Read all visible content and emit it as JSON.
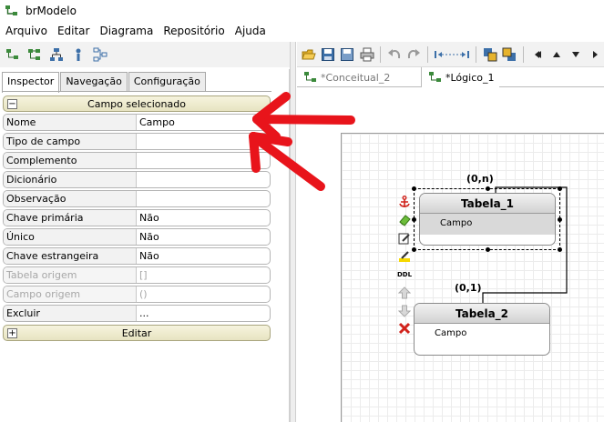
{
  "window": {
    "title": "brModelo"
  },
  "menu": [
    "Arquivo",
    "Editar",
    "Diagrama",
    "Repositório",
    "Ajuda"
  ],
  "left_tabs": [
    "Inspector",
    "Navegação",
    "Configuração"
  ],
  "inspector": {
    "header": "Campo selecionado",
    "footer": "Editar",
    "rows": [
      {
        "key": "Nome",
        "value": "Campo",
        "enabled": true
      },
      {
        "key": "Tipo de campo",
        "value": "",
        "enabled": true
      },
      {
        "key": "Complemento",
        "value": "",
        "enabled": true
      },
      {
        "key": "Dicionário",
        "value": "",
        "enabled": true
      },
      {
        "key": "Observação",
        "value": "",
        "enabled": true
      },
      {
        "key": "Chave primária",
        "value": "Não",
        "enabled": true
      },
      {
        "key": "Único",
        "value": "Não",
        "enabled": true
      },
      {
        "key": "Chave estrangeira",
        "value": "Não",
        "enabled": true
      },
      {
        "key": "Tabela origem",
        "value": "[]",
        "enabled": false
      },
      {
        "key": "Campo origem",
        "value": "()",
        "enabled": false
      },
      {
        "key": "Excluir",
        "value": "...",
        "enabled": true
      }
    ]
  },
  "doc_tabs": [
    "*Conceitual_2",
    "*Lógico_1"
  ],
  "diagram": {
    "tables": [
      {
        "name": "Tabela_1",
        "field": "Campo",
        "selected": true
      },
      {
        "name": "Tabela_2",
        "field": "Campo",
        "selected": false
      }
    ],
    "cardinalities": [
      "(0,n)",
      "(0,1)"
    ],
    "ddl_label": "DDL"
  },
  "colors": {
    "arrow": "#e8141b",
    "header_fill": "#ece8c8",
    "grid": "#ececec"
  }
}
